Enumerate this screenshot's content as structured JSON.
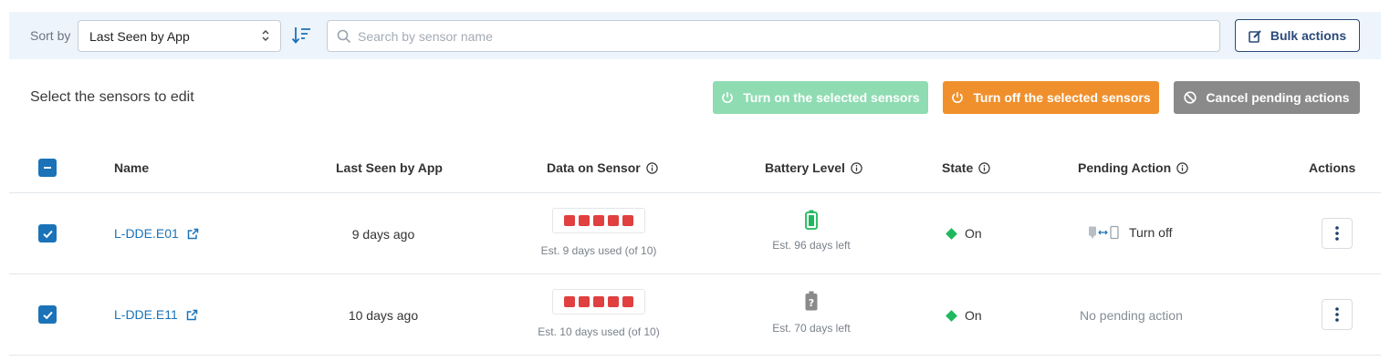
{
  "toolbar": {
    "sort_label": "Sort by",
    "sort_value": "Last Seen by App",
    "search_placeholder": "Search by sensor name",
    "bulk_label": "Bulk actions"
  },
  "actions": {
    "title": "Select the sensors to edit",
    "turn_on_label": "Turn on the selected sensors",
    "turn_off_label": "Turn off the selected sensors",
    "cancel_label": "Cancel pending actions"
  },
  "table": {
    "headers": {
      "name": "Name",
      "last_seen": "Last Seen by App",
      "data": "Data on Sensor",
      "battery": "Battery Level",
      "state": "State",
      "pending": "Pending Action",
      "actions": "Actions"
    },
    "rows": [
      {
        "selected": true,
        "name": "L-DDE.E01",
        "last_seen": "9 days ago",
        "data_note": "Est. 9 days used (of 10)",
        "battery_status": "charged",
        "battery_note": "Est. 96 days left",
        "state": "On",
        "pending": "Turn off"
      },
      {
        "selected": true,
        "name": "L-DDE.E11",
        "last_seen": "10 days ago",
        "data_note": "Est. 10 days used (of 10)",
        "battery_status": "unknown",
        "battery_note": "Est. 70 days left",
        "state": "On",
        "pending": "No pending action"
      }
    ]
  },
  "colors": {
    "accent": "#1a73b8",
    "turn_on": "#8fdcb2",
    "turn_off": "#f0902c",
    "cancel": "#8a8a8a",
    "data_block": "#e04040",
    "state_on": "#1fb85e",
    "battery_ok": "#1fb85e",
    "battery_unknown": "#8a8a8a"
  }
}
